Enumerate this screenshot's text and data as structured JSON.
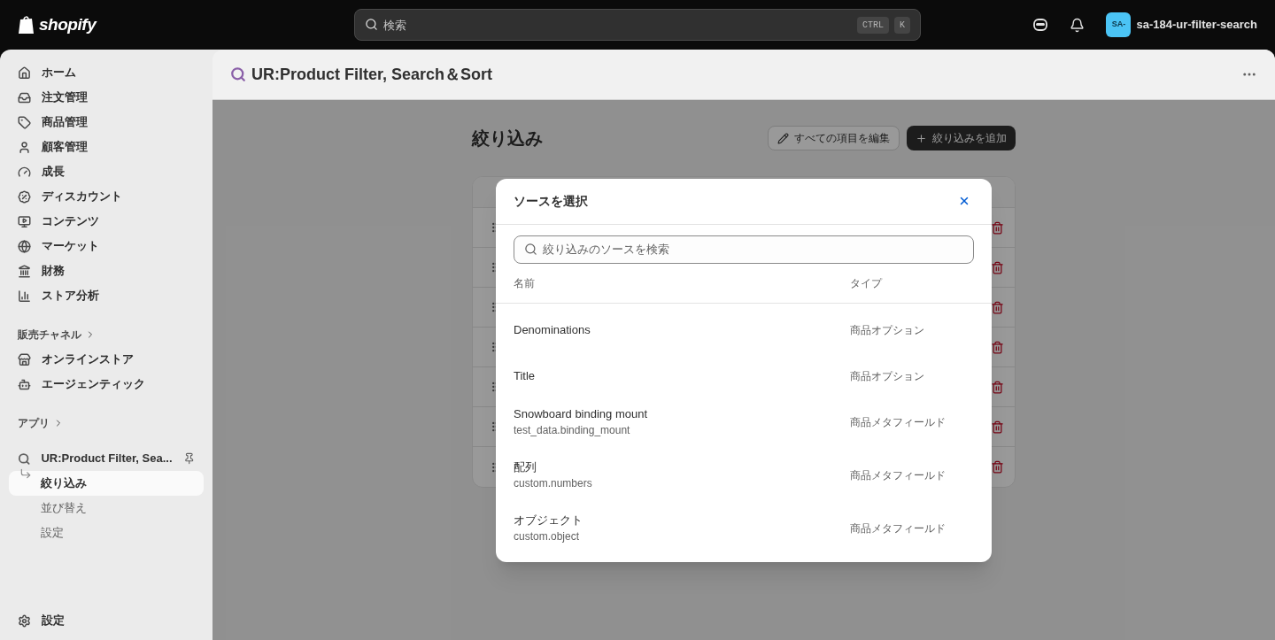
{
  "topbar": {
    "logo": "shopify",
    "search": {
      "placeholder": "検索",
      "keys": [
        "CTRL",
        "K"
      ]
    },
    "store": {
      "avatar": "SA-",
      "name": "sa-184-ur-filter-search"
    }
  },
  "sidebar": {
    "items": [
      {
        "label": "ホーム"
      },
      {
        "label": "注文管理"
      },
      {
        "label": "商品管理"
      },
      {
        "label": "顧客管理"
      },
      {
        "label": "成長"
      },
      {
        "label": "ディスカウント"
      },
      {
        "label": "コンテンツ"
      },
      {
        "label": "マーケット"
      },
      {
        "label": "財務"
      },
      {
        "label": "ストア分析"
      }
    ],
    "channels_heading": "販売チャネル",
    "channels": [
      {
        "label": "オンラインストア"
      },
      {
        "label": "エージェンティック"
      }
    ],
    "apps_heading": "アプリ",
    "app": {
      "name": "UR:Product Filter, Sea...",
      "children": [
        {
          "label": "絞り込み",
          "selected": true
        },
        {
          "label": "並び替え",
          "selected": false
        },
        {
          "label": "設定",
          "selected": false
        }
      ]
    },
    "settings": "設定"
  },
  "page": {
    "app_title": "UR:Product Filter, Search＆Sort",
    "heading": "絞り込み",
    "buttons": [
      {
        "kind": "secondary",
        "label": "すべての項目を編集"
      },
      {
        "kind": "primary",
        "label": "絞り込みを追加"
      }
    ]
  },
  "modal": {
    "title": "ソースを選択",
    "search": {
      "placeholder": "絞り込みのソースを検索"
    },
    "columns": [
      "名前",
      "タイプ"
    ],
    "rows": [
      {
        "name": "Denominations",
        "type": "商品オプション"
      },
      {
        "name": "Title",
        "type": "商品オプション"
      },
      {
        "name": "Snowboard binding mount",
        "key": "test_data.binding_mount",
        "type": "商品メタフィールド"
      },
      {
        "name": "配列",
        "key": "custom.numbers",
        "type": "商品メタフィールド"
      },
      {
        "name": "オブジェクト",
        "key": "custom.object",
        "type": "商品メタフィールド"
      }
    ]
  }
}
